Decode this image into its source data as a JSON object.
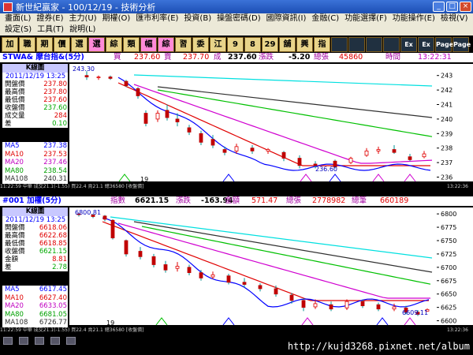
{
  "window": {
    "title": "新世紀贏家 - 100/12/19 - 技術分析"
  },
  "menu": {
    "row1": [
      "畫面(L)",
      "證券(E)",
      "主力(U)",
      "期權(O)",
      "匯市利率(E)",
      "投資(B)",
      "操盤密碼(D)",
      "國際資訊(I)",
      "金融(C)",
      "功能選擇(F)",
      "功能操作(E)"
    ],
    "row2": [
      "檢視(V)",
      "設定(S)",
      "工具(T)",
      "說明(L)"
    ]
  },
  "toolbar": [
    "加",
    "職",
    "期",
    "價",
    "選",
    "選",
    "綜",
    "類",
    "幅",
    "綜",
    "習",
    "委",
    "江",
    "9",
    "8",
    "29",
    "舖",
    "興",
    "指",
    "",
    "",
    "",
    "",
    "Ex",
    "Ex",
    "Page",
    "Page"
  ],
  "panel1": {
    "quote": {
      "symbol": "STWA& 摩台指&(5分)",
      "buy_label": "買",
      "buy": "237.60",
      "sell_label": "賣",
      "sell": "237.70",
      "deal_label": "成",
      "deal": "237.60",
      "change_label": "漲跌",
      "change": "-5.20",
      "vol_label": "總張",
      "vol": "45860",
      "time_label": "時間",
      "time": "13:22:31"
    },
    "info": {
      "header": "K線圖",
      "date": "2011/12/19 13:25",
      "rows": [
        {
          "k": "開盤價",
          "v": "237.80"
        },
        {
          "k": "最高價",
          "v": "237.80"
        },
        {
          "k": "最低價",
          "v": "237.60"
        },
        {
          "k": "收盤價",
          "v": "237.60"
        },
        {
          "k": "成交量",
          "v": "284"
        },
        {
          "k": "差",
          "v": "0.10"
        }
      ]
    },
    "ma": [
      {
        "k": "MA5",
        "v": "237.38",
        "color": "#0000ff"
      },
      {
        "k": "MA10",
        "v": "237.53",
        "color": "#e00000"
      },
      {
        "k": "MA20",
        "v": "237.46",
        "color": "#c000c0"
      },
      {
        "k": "MA80",
        "v": "238.54",
        "color": "#00c000"
      },
      {
        "k": "MA108",
        "v": "240.31",
        "color": "#303030"
      }
    ],
    "high_label": "243.30",
    "low_label": "236.60",
    "x_label": "19",
    "y_ticks": [
      "243",
      "242",
      "241",
      "240",
      "239",
      "238",
      "237",
      "236"
    ],
    "y_range": [
      235.7,
      243.8
    ],
    "status": "11:22:59 中華 成交21.1(-1.55) 買22.4 賣21.1 總36580 [收盤價]",
    "status_right": "13:22:36"
  },
  "panel2": {
    "quote": {
      "symbol": "#001 加權(5分)",
      "idx_label": "指數",
      "idx": "6621.15",
      "change_label": "漲跌",
      "change": "-163.94",
      "amt_label": "金額",
      "amt": "571.47",
      "vol_label": "總張",
      "vol": "2778982",
      "cnt_label": "總筆",
      "cnt": "660189"
    },
    "info": {
      "header": "K線圖",
      "date": "2011/12/19 13:25",
      "rows": [
        {
          "k": "開盤價",
          "v": "6618.06"
        },
        {
          "k": "最高價",
          "v": "6622.68"
        },
        {
          "k": "最低價",
          "v": "6618.85"
        },
        {
          "k": "收盤價",
          "v": "6621.15"
        },
        {
          "k": "金額",
          "v": "8.81"
        },
        {
          "k": "差",
          "v": "2.78"
        }
      ]
    },
    "ma": [
      {
        "k": "MA5",
        "v": "6617.45",
        "color": "#0000ff"
      },
      {
        "k": "MA10",
        "v": "6627.40",
        "color": "#e00000"
      },
      {
        "k": "MA20",
        "v": "6633.05",
        "color": "#c000c0"
      },
      {
        "k": "MA80",
        "v": "6681.05",
        "color": "#00c000"
      },
      {
        "k": "MA108",
        "v": "6726.77",
        "color": "#303030"
      }
    ],
    "high_label": "6800.81",
    "low_label": "6609.11",
    "x_label": "19",
    "y_ticks": [
      "6800",
      "6775",
      "6750",
      "6725",
      "6700",
      "6675",
      "6650",
      "6625",
      "6600"
    ],
    "y_range": [
      6592,
      6812
    ],
    "status": "11:22:59 中華 成交21.1(-1.55) 買22.4 賣21.1 總36580 [收盤價]",
    "status_right": "13:22:36"
  },
  "footer_url": "http://kujd3268.pixnet.net/album"
}
